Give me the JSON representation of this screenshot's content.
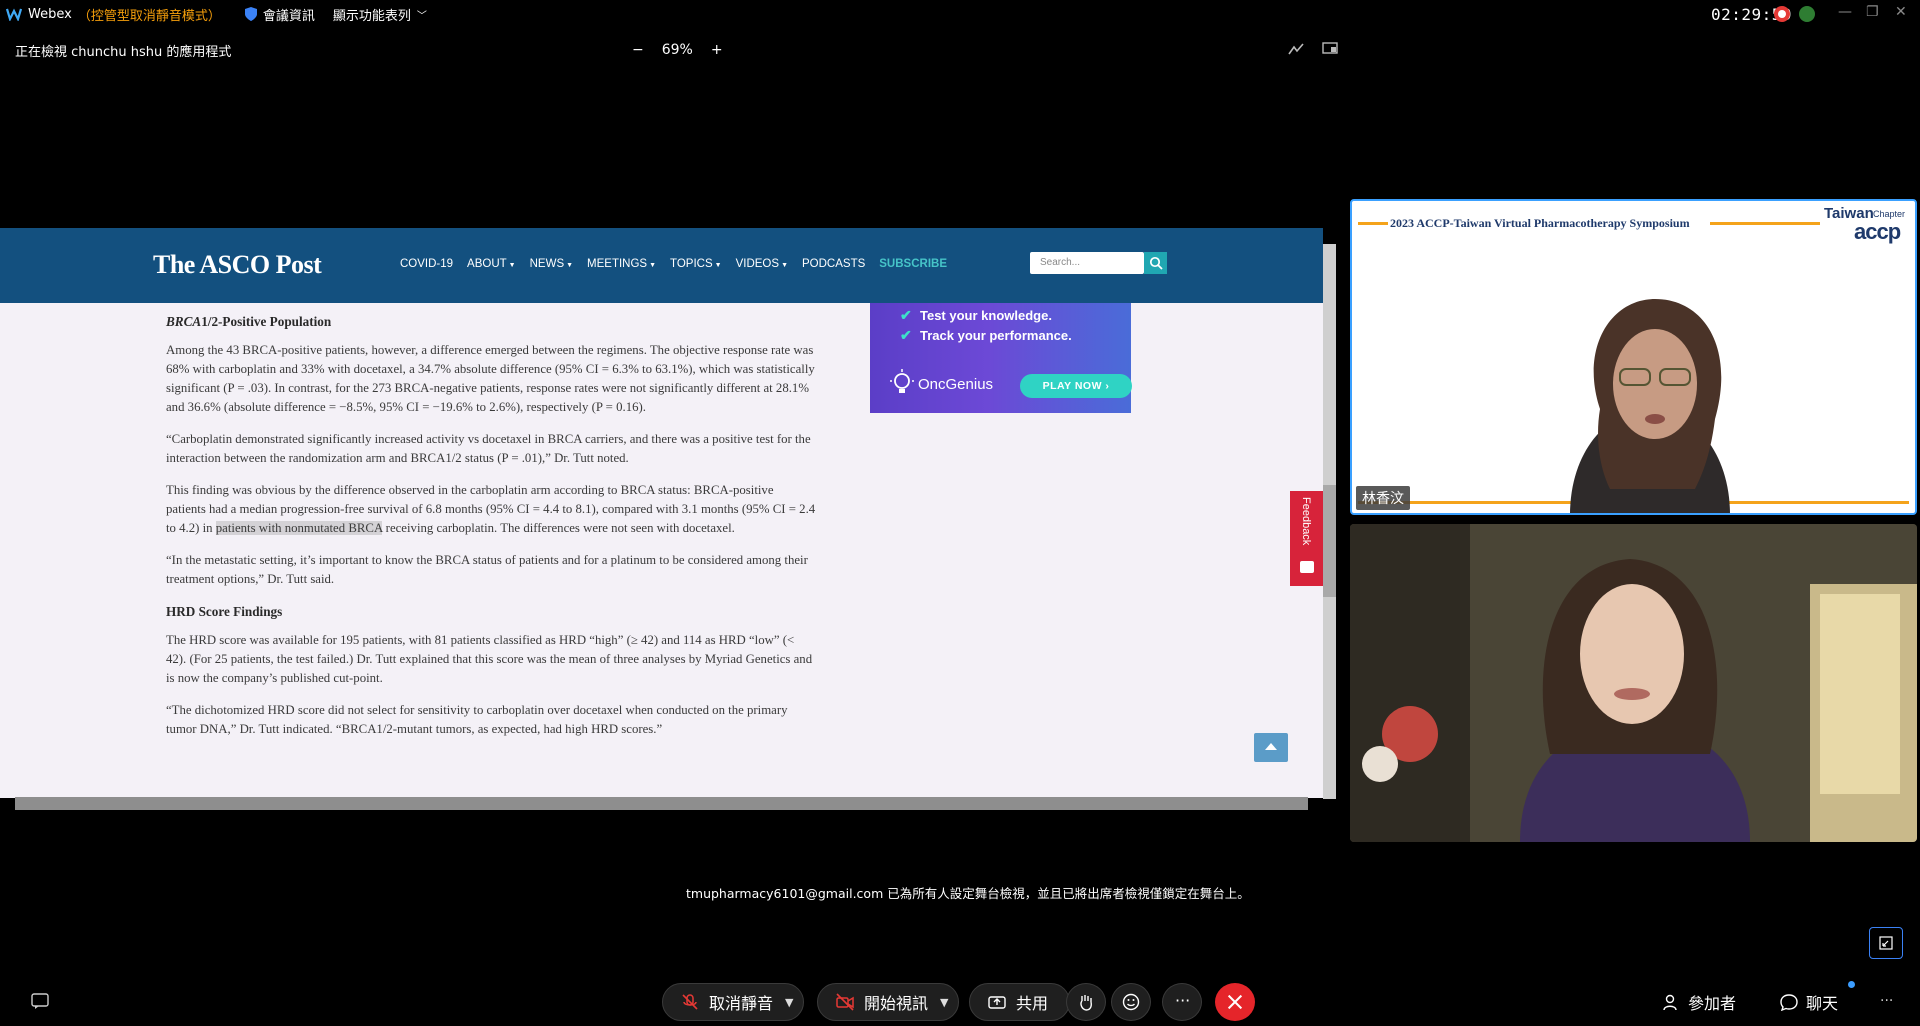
{
  "titlebar": {
    "app_name": "Webex",
    "mode_label": "（控管型取消靜音模式）",
    "meeting_info": "會議資訊",
    "show_menu": "顯示功能表列",
    "time": "02:29:59"
  },
  "viewbar": {
    "viewing_label": "正在檢視 chunchu hshu 的應用程式",
    "zoom": "69%",
    "zoom_out": "−",
    "zoom_in": "+"
  },
  "site": {
    "logo": "The ASCO Post",
    "nav": [
      "COVID-19",
      "ABOUT",
      "NEWS",
      "MEETINGS",
      "TOPICS",
      "VIDEOS",
      "PODCASTS",
      "SUBSCRIBE"
    ],
    "search_placeholder": "Search..."
  },
  "ad": {
    "line1": "Test your knowledge.",
    "line2": "Track your performance.",
    "brand": "OncGenius",
    "cta": "PLAY NOW ›"
  },
  "feedback": "Feedback",
  "article": {
    "h1_italic": "BRCA",
    "h1_rest": "1/2-Positive Population",
    "p1": "Among the 43 BRCA-positive patients, however, a difference emerged between the regimens. The objective response rate was 68% with carboplatin and 33% with docetaxel, a 34.7% absolute difference (95% CI = 6.3% to 63.1%), which was statistically significant (P = .03). In contrast, for the 273 BRCA-negative patients, response rates were not significantly different at 28.1% and 36.6% (absolute difference = −8.5%, 95% CI = −19.6% to 2.6%), respectively (P = 0.16).",
    "p2": "“Carboplatin demonstrated significantly increased activity vs docetaxel in BRCA carriers, and there was a positive test for the interaction between the randomization arm and BRCA1/2 status (P = .01),” Dr. Tutt noted.",
    "p3_a": "This finding was obvious by the difference observed in the carboplatin arm according to BRCA status: BRCA-positive patients had a median progression-free survival of 6.8 months (95% CI = 4.4 to 8.1), compared with 3.1 months (95% CI = 2.4 to 4.2) in ",
    "p3_hl": "patients with nonmutated BRCA",
    "p3_b": " receiving carboplatin. The differences were not seen with docetaxel.",
    "p4": "“In the metastatic setting, it’s important to know the BRCA status of patients and for a platinum to be considered among their treatment options,” Dr. Tutt said.",
    "h2": "HRD Score Findings",
    "p5": "The HRD score was available for 195 patients, with 81 patients classified as HRD “high” (≥ 42) and 114 as HRD “low” (< 42). (For 25 patients, the test failed.) Dr. Tutt explained that this score was the mean of three analyses by Myriad Genetics and is now the company’s published cut-point.",
    "p6": "“The dichotomized HRD score did not select for sensitivity to carboplatin over docetaxel when conducted on the primary tumor DNA,” Dr. Tutt indicated. “BRCA1/2-mutant tumors, as expected, had high HRD scores.”"
  },
  "notice": "tmupharmacy6101@gmail.com 已為所有人設定舞台檢視，並且已將出席者檢視僅鎖定在舞台上。",
  "tiles": {
    "slide_title": "2023 ACCP-Taiwan Virtual Pharmacotherapy Symposium",
    "brand_top": "Taiwan",
    "brand_chapter": "Chapter",
    "brand_main": "accp",
    "speaker_name": "林香汶"
  },
  "controls": {
    "unmute": "取消靜音",
    "start_video": "開始視訊",
    "share": "共用",
    "participants": "參加者",
    "chat": "聊天"
  },
  "colors": {
    "asco_blue": "#13507f",
    "subscribe": "#46c4c8",
    "end_call": "#e5252a",
    "active_border": "#3aa0ff"
  }
}
